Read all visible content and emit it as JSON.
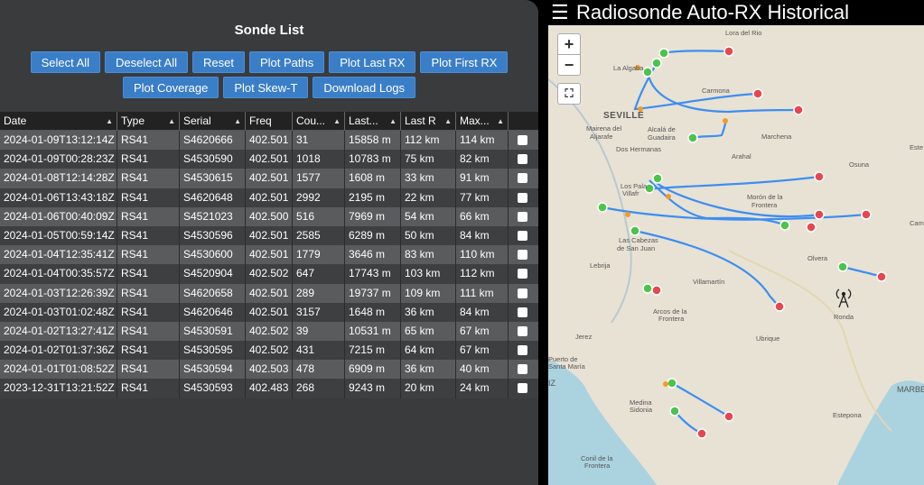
{
  "panel": {
    "title": "Sonde List",
    "buttons_row1": [
      "Select All",
      "Deselect All",
      "Reset",
      "Plot Paths",
      "Plot Last RX",
      "Plot First RX"
    ],
    "buttons_row2": [
      "Plot Coverage",
      "Plot Skew-T",
      "Download Logs"
    ]
  },
  "table": {
    "headers": [
      "Date",
      "Type",
      "Serial",
      "Freq",
      "Cou...",
      "Last...",
      "Last R",
      "Max...",
      ""
    ],
    "rows": [
      [
        "2024-01-09T13:12:14Z",
        "RS41",
        "S4620666",
        "402.501",
        "31",
        "15858 m",
        "112 km",
        "114 km"
      ],
      [
        "2024-01-09T00:28:23Z",
        "RS41",
        "S4530590",
        "402.501",
        "1018",
        "10783 m",
        "75 km",
        "82 km"
      ],
      [
        "2024-01-08T12:14:28Z",
        "RS41",
        "S4530615",
        "402.501",
        "1577",
        "1608 m",
        "33 km",
        "91 km"
      ],
      [
        "2024-01-06T13:43:18Z",
        "RS41",
        "S4620648",
        "402.501",
        "2992",
        "2195 m",
        "22 km",
        "77 km"
      ],
      [
        "2024-01-06T00:40:09Z",
        "RS41",
        "S4521023",
        "402.500",
        "516",
        "7969 m",
        "54 km",
        "66 km"
      ],
      [
        "2024-01-05T00:59:14Z",
        "RS41",
        "S4530596",
        "402.501",
        "2585",
        "6289 m",
        "50 km",
        "84 km"
      ],
      [
        "2024-01-04T12:35:41Z",
        "RS41",
        "S4530600",
        "402.501",
        "1779",
        "3646 m",
        "83 km",
        "110 km"
      ],
      [
        "2024-01-04T00:35:57Z",
        "RS41",
        "S4520904",
        "402.502",
        "647",
        "17743 m",
        "103 km",
        "112 km"
      ],
      [
        "2024-01-03T12:26:39Z",
        "RS41",
        "S4620658",
        "402.501",
        "289",
        "19737 m",
        "109 km",
        "111 km"
      ],
      [
        "2024-01-03T01:02:48Z",
        "RS41",
        "S4620646",
        "402.501",
        "3157",
        "1648 m",
        "36 km",
        "84 km"
      ],
      [
        "2024-01-02T13:27:41Z",
        "RS41",
        "S4530591",
        "402.502",
        "39",
        "10531 m",
        "65 km",
        "67 km"
      ],
      [
        "2024-01-02T01:37:36Z",
        "RS41",
        "S4530595",
        "402.502",
        "431",
        "7215 m",
        "64 km",
        "67 km"
      ],
      [
        "2024-01-01T01:08:52Z",
        "RS41",
        "S4530594",
        "402.503",
        "478",
        "6909 m",
        "36 km",
        "40 km"
      ],
      [
        "2023-12-31T13:21:52Z",
        "RS41",
        "S4530593",
        "402.483",
        "268",
        "9243 m",
        "20 km",
        "24 km"
      ]
    ]
  },
  "map": {
    "title": "Radiosonde Auto-RX Historical",
    "zoom_in": "+",
    "zoom_out": "−",
    "fullscreen": "⛶",
    "labels": {
      "lora": "Lora del Rio",
      "algaba": "La Algaba",
      "carmona": "Carmona",
      "seville": "SEVILLE",
      "mairena": "Mairena del",
      "aljarafe": "Aljarafe",
      "alcala": "Alcalá de",
      "guadaira": "Guadaira",
      "marchena": "Marchena",
      "dos": "Dos Hermanas",
      "arahal": "Arahal",
      "este": "Este",
      "osuna": "Osuna",
      "lospal": "Los Pala",
      "villafr": "Villafr",
      "moron": "Morón de la",
      "frontera1": "Frontera",
      "cam": "Cam",
      "cabezas": "Las Cabezas",
      "sanjuan": "de San Juan",
      "lebrija": "Lebrija",
      "olvera": "Olvera",
      "villamartin": "Villamartín",
      "ronda": "Ronda",
      "arcos": "Arcos de la",
      "frontera2": "Frontera",
      "jerez": "Jerez",
      "ubrique": "Ubrique",
      "puerto": "Puerto de",
      "santamaria": "Santa María",
      "iz": "IZ",
      "marbe": "MARBE",
      "medina": "Medina",
      "sidonia": "Sidonia",
      "estepona": "Estepona",
      "conil": "Conil de la",
      "frontera3": "Frontera"
    }
  },
  "colors": {
    "button": "#3a7ec8",
    "path": "#3d8ef0",
    "panel": "#3a3b3d"
  }
}
